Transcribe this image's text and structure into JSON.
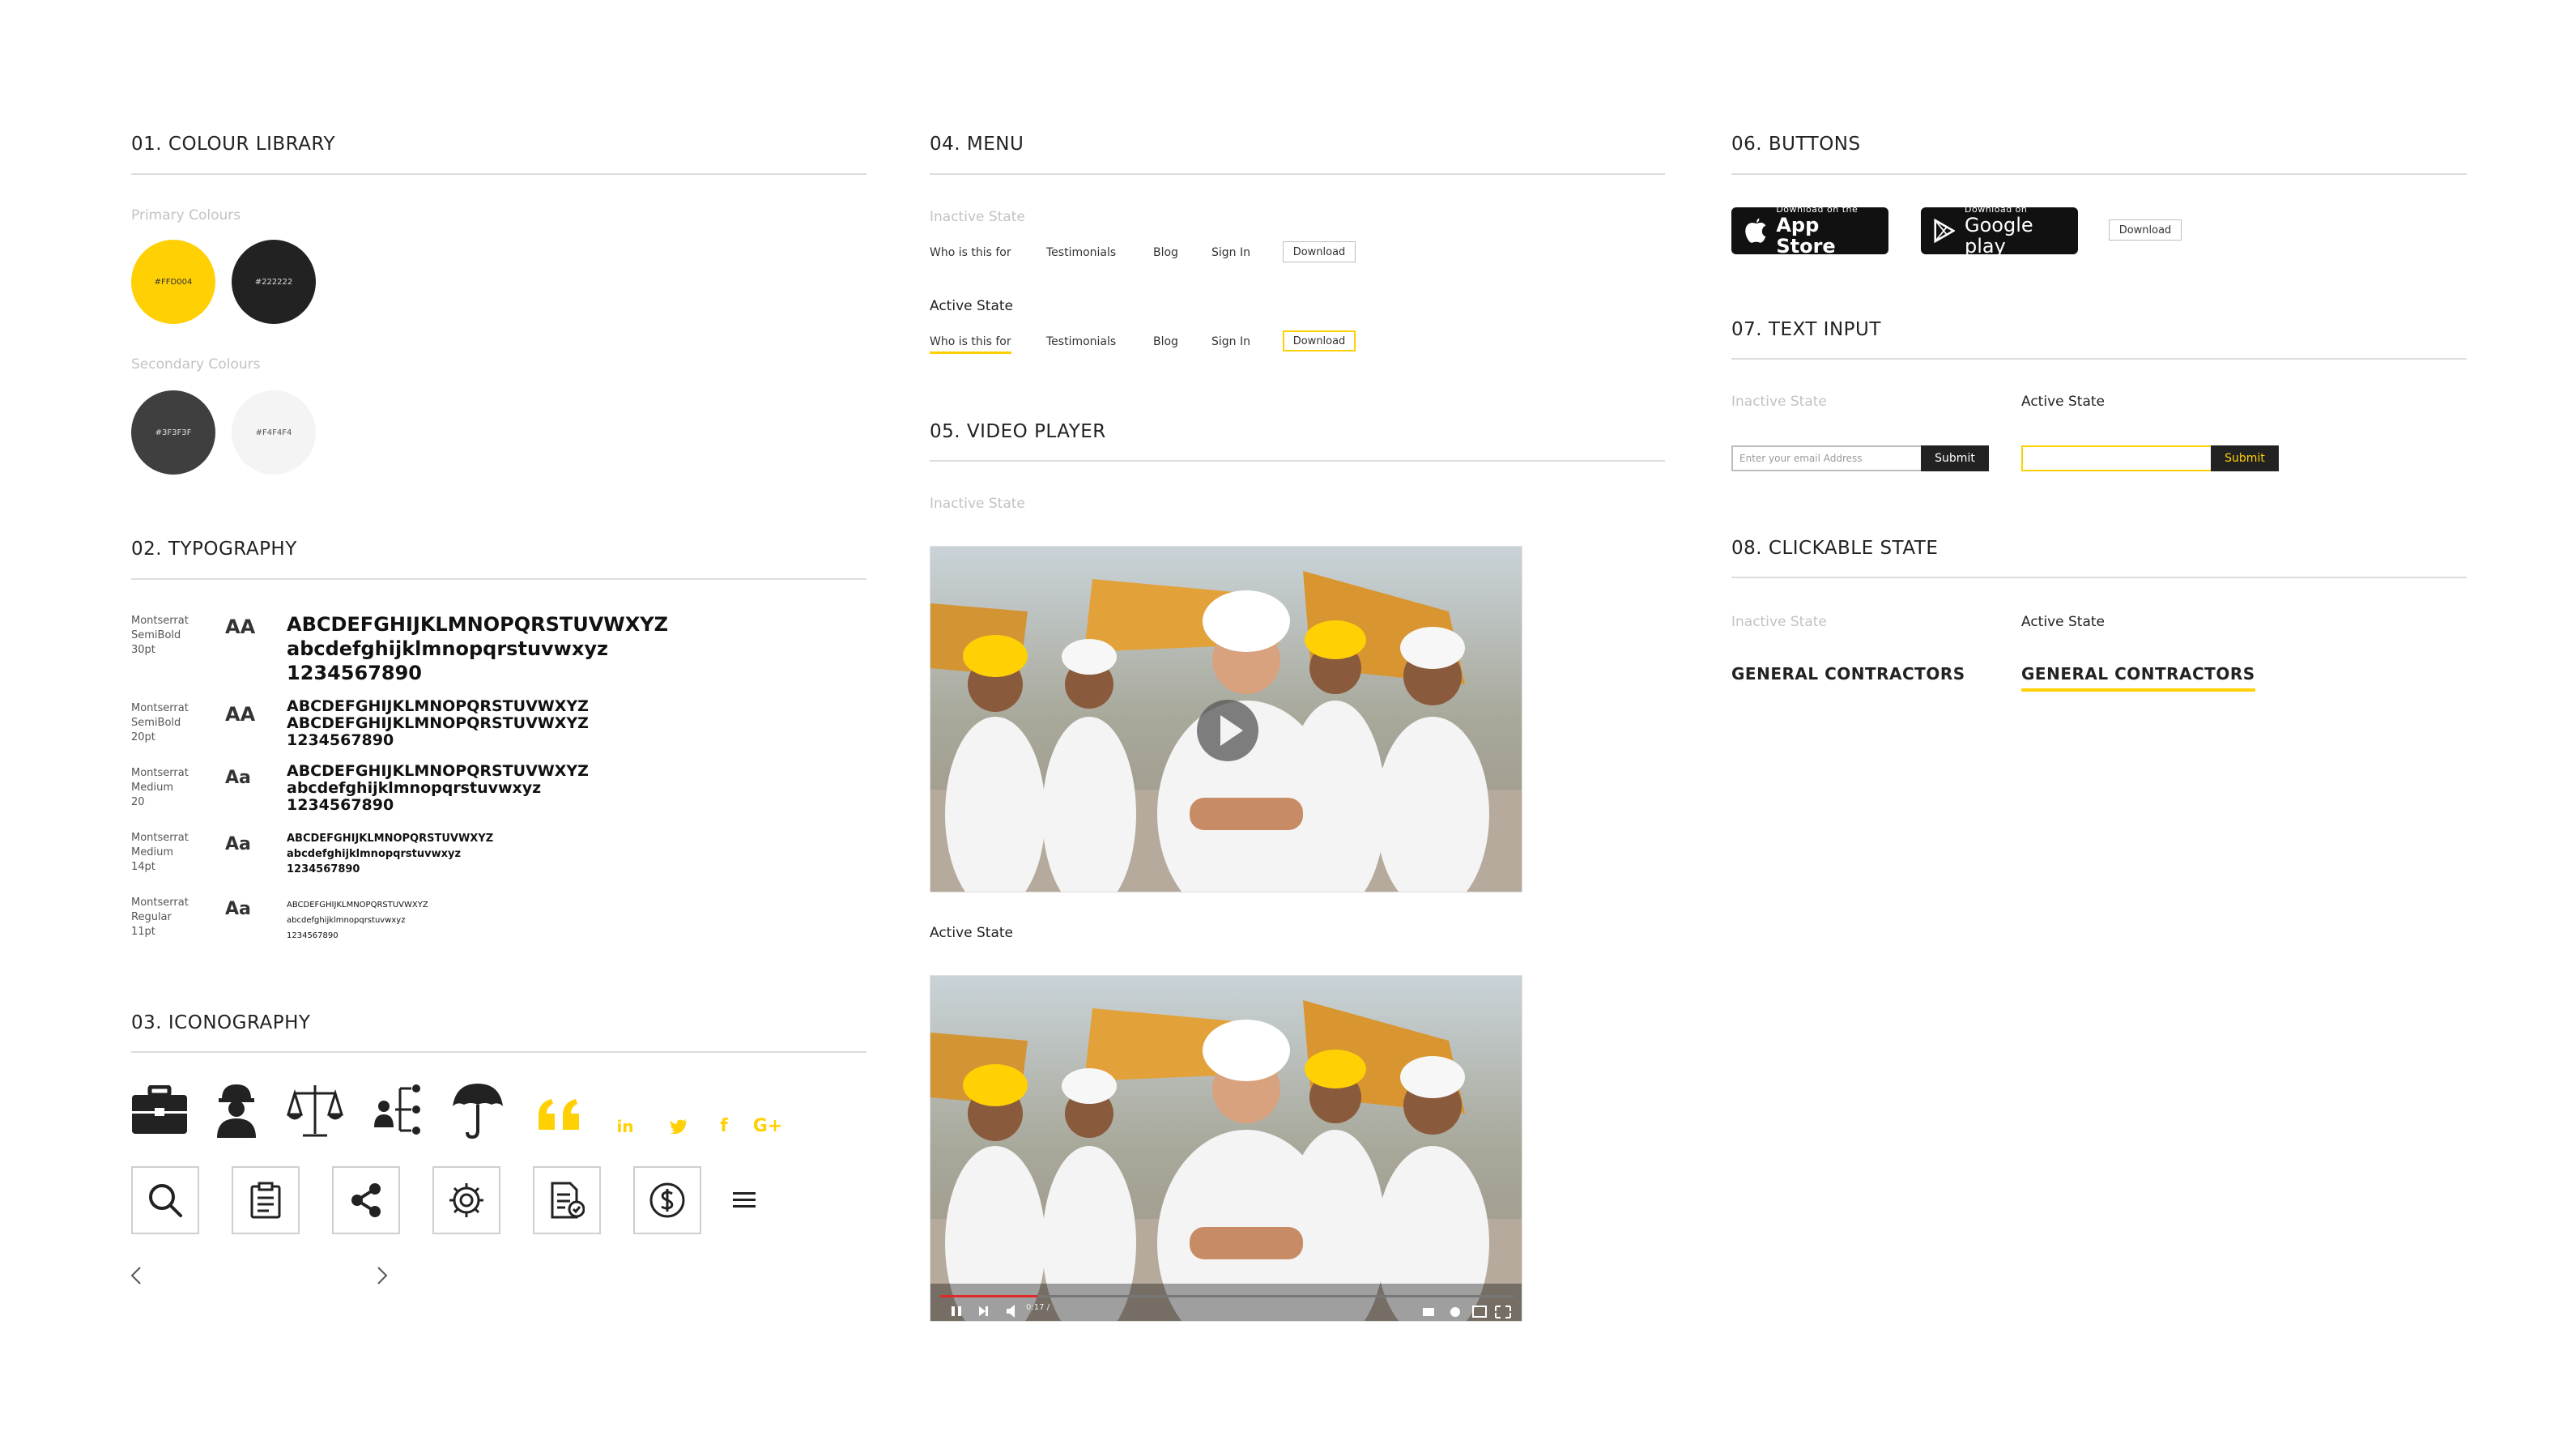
{
  "colors": {
    "yellow": "#FFD004",
    "dark": "#222222",
    "gray": "#3F3F3F",
    "light": "#F4F4F4"
  },
  "colour_library": {
    "title": "01. COLOUR LIBRARY",
    "primary_label": "Primary Colours",
    "secondary_label": "Secondary Colours",
    "primary": [
      {
        "hex": "#FFD004"
      },
      {
        "hex": "#222222"
      }
    ],
    "secondary": [
      {
        "hex": "#3F3F3F"
      },
      {
        "hex": "#F4F4F4"
      }
    ]
  },
  "typography": {
    "title": "02. TYPOGRAPHY",
    "rows": [
      {
        "meta1": "Montserrat",
        "meta2": "SemiBold",
        "meta3": "30pt",
        "aa": "AA",
        "l1": "ABCDEFGHIJKLMNOPQRSTUVWXYZ",
        "l2": "abcdefghijklmnopqrstuvwxyz",
        "l3": "1234567890"
      },
      {
        "meta1": "Montserrat",
        "meta2": "SemiBold",
        "meta3": "20pt",
        "aa": "AA",
        "l1": "ABCDEFGHIJKLMNOPQRSTUVWXYZ",
        "l2": "ABCDEFGHIJKLMNOPQRSTUVWXYZ",
        "l3": "1234567890"
      },
      {
        "meta1": "Montserrat",
        "meta2": "Medium",
        "meta3": "20",
        "aa": "Aa",
        "l1": "ABCDEFGHIJKLMNOPQRSTUVWXYZ",
        "l2": "abcdefghijklmnopqrstuvwxyz",
        "l3": "1234567890"
      },
      {
        "meta1": "Montserrat",
        "meta2": "Medium",
        "meta3": "14pt",
        "aa": "Aa",
        "l1": "ABCDEFGHIJKLMNOPQRSTUVWXYZ",
        "l2": "abcdefghijklmnopqrstuvwxyz",
        "l3": "1234567890"
      },
      {
        "meta1": "Montserrat",
        "meta2": "Regular",
        "meta3": "11pt",
        "aa": "Aa",
        "l1": "ABCDEFGHIJKLMNOPQRSTUVWXYZ",
        "l2": "abcdefghijklmnopqrstuvwxyz",
        "l3": "1234567890"
      }
    ]
  },
  "iconography": {
    "title": "03. ICONOGRAPHY",
    "row1": [
      "briefcase-icon",
      "worker-icon",
      "scales-icon",
      "org-chart-icon",
      "umbrella-icon",
      "quote-icon",
      "linkedin-icon",
      "twitter-icon",
      "facebook-icon",
      "google-icon"
    ],
    "row2": [
      "search-icon",
      "clipboard-icon",
      "share-icon",
      "gear-icon",
      "document-check-icon",
      "dollar-icon",
      "hamburger-icon"
    ],
    "row3": [
      "chevron-left-icon",
      "chevron-right-icon"
    ]
  },
  "menu": {
    "title": "04. MENU",
    "inactive_label": "Inactive State",
    "active_label": "Active State",
    "items": [
      "Who is this for",
      "Testimonials",
      "Blog",
      "Sign In"
    ],
    "download": "Download"
  },
  "video_player": {
    "title": "05. VIDEO PLAYER",
    "inactive_label": "Inactive State",
    "active_label": "Active State",
    "time": "0:17 /",
    "progress": 0.17
  },
  "buttons": {
    "title": "06. BUTTONS",
    "appstore_small": "Download on the",
    "appstore_big": "App Store",
    "google_small": "Download on",
    "google_big": "Google play",
    "download": "Download"
  },
  "text_input": {
    "title": "07. TEXT INPUT",
    "inactive_label": "Inactive State",
    "active_label": "Active State",
    "placeholder": "Enter your email Address",
    "submit": "Submit"
  },
  "clickable": {
    "title": "08. CLICKABLE STATE",
    "inactive_label": "Inactive State",
    "active_label": "Active State",
    "text": "GENERAL CONTRACTORS"
  }
}
